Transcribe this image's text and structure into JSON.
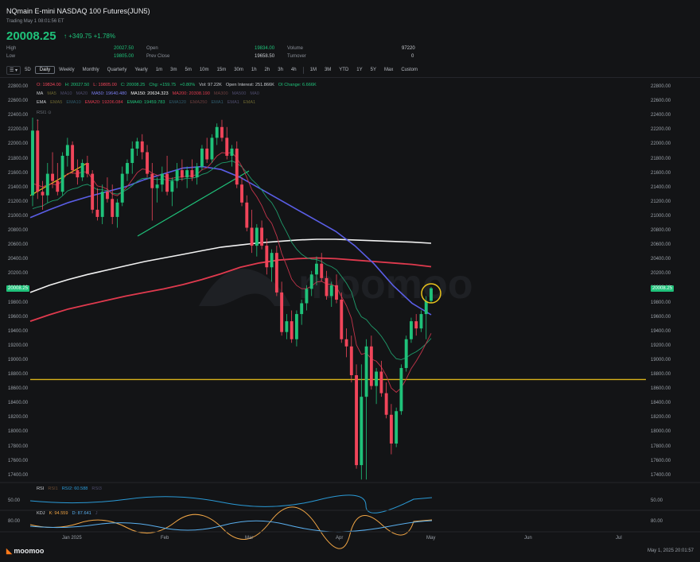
{
  "header": {
    "title": "NQmain  E-mini NASDAQ 100 Futures(JUN5)",
    "status": "Trading May 1 08:01:56 ET",
    "price": "20008.25",
    "arrow": "↑",
    "change": "+349.75 +1.78%"
  },
  "stats": [
    {
      "label": "High",
      "value": "20027.50",
      "color": "green"
    },
    {
      "label": "Low",
      "value": "19805.00",
      "color": "green"
    },
    {
      "label": "Open",
      "value": "19834.00",
      "color": "green"
    },
    {
      "label": "Prev Close",
      "value": "19658.50",
      "color": "plain"
    },
    {
      "label": "Volume",
      "value": "97220",
      "color": "plain"
    },
    {
      "label": "Turnover",
      "value": "0",
      "color": "plain"
    }
  ],
  "timeframes": [
    "5D",
    "Daily",
    "Weekly",
    "Monthly",
    "Quarterly",
    "Yearly",
    "1m",
    "3m",
    "5m",
    "10m",
    "15m",
    "30m",
    "1h",
    "2h",
    "3h",
    "4h",
    "1M",
    "3M",
    "YTD",
    "1Y",
    "5Y",
    "Max",
    "Custom"
  ],
  "active_timeframe": "Daily",
  "ohlc_legend": {
    "o": "O: 19834.00",
    "h": "H: 20027.50",
    "l": "L: 19805.00",
    "c": "C: 20008.25",
    "chg": "Chg: +159.75",
    "pct": "+0.80%",
    "vol": "Vol: 97.22K",
    "oi": "Open Interest: 251.866K",
    "oic": "OI Change: 6.666K"
  },
  "ma_legend": {
    "label": "MA",
    "ma5": "MA5",
    "ma10": "MA10",
    "ma20": "MA20",
    "ma50": "MA50: 19640.480",
    "ma150": "MA150: 20634.323",
    "ma200": "MA200: 20308.190",
    "ma300": "MA300",
    "ma500": "MA500",
    "ma0": "MA0"
  },
  "ema_legend": {
    "label": "EMA",
    "ema5": "EMA5",
    "ema10": "EMA10",
    "ema20": "EMA20: 19206.084",
    "ema40": "EMA40: 19459.783",
    "ema120": "EMA120",
    "ema250": "EMA250",
    "ema1a": "EMA1",
    "ema1b": "EMA1",
    "ema1c": "EMA1"
  },
  "rsi_small": "RSI1 ⊙",
  "price_axis": [
    "22800.00",
    "22600.00",
    "22400.00",
    "22200.00",
    "22000.00",
    "21800.00",
    "21600.00",
    "21400.00",
    "21200.00",
    "21000.00",
    "20800.00",
    "20600.00",
    "20400.00",
    "20200.00",
    "20000.00",
    "19800.00",
    "19600.00",
    "19400.00",
    "19200.00",
    "19000.00",
    "18800.00",
    "18600.00",
    "18400.00",
    "18200.00",
    "18000.00",
    "17800.00",
    "17600.00",
    "17400.00"
  ],
  "price_tag": "20008.25",
  "watermark": "moomoo",
  "rsi_panel": {
    "label": "RSI",
    "r1": "RSI1",
    "r2": "RSI2: 60.588",
    "r3": "RSI3",
    "level": "50.00"
  },
  "kdj_panel": {
    "label": "KDJ",
    "k": "K: 94.559",
    "d": "D: 87.641",
    "j": "J",
    "level": "80.00"
  },
  "x_axis": [
    "Jan 2025",
    "Feb",
    "Mar",
    "Apr",
    "May",
    "Jun",
    "Jul"
  ],
  "footer": {
    "logo": "moomoo",
    "time": "May 1, 2025 20:01:57"
  },
  "colors": {
    "up": "#1fc27a",
    "down": "#f0455a",
    "ma50": "#5a5ee6",
    "ma150": "#f2f2f2",
    "ma200": "#e03a4e",
    "ema40": "#1f9c6b",
    "ema20": "#c2344a",
    "support": "#d9b21a",
    "highlight": "#e8c21b"
  },
  "chart_data": {
    "type": "candlestick",
    "ylim": [
      17200,
      22900
    ],
    "support_level": 18740,
    "candles": [
      {
        "o": 21300,
        "h": 22380,
        "l": 21150,
        "c": 22200
      },
      {
        "o": 22200,
        "h": 22350,
        "l": 21250,
        "c": 21350
      },
      {
        "o": 21350,
        "h": 21500,
        "l": 21100,
        "c": 21300
      },
      {
        "o": 21300,
        "h": 21750,
        "l": 21200,
        "c": 21600
      },
      {
        "o": 21600,
        "h": 21900,
        "l": 21400,
        "c": 21500
      },
      {
        "o": 21500,
        "h": 21750,
        "l": 21300,
        "c": 21350
      },
      {
        "o": 21350,
        "h": 21900,
        "l": 21300,
        "c": 21850
      },
      {
        "o": 21850,
        "h": 22100,
        "l": 21700,
        "c": 22000
      },
      {
        "o": 22000,
        "h": 22050,
        "l": 21600,
        "c": 21650
      },
      {
        "o": 21650,
        "h": 21800,
        "l": 21450,
        "c": 21550
      },
      {
        "o": 21550,
        "h": 21800,
        "l": 21500,
        "c": 21750
      },
      {
        "o": 21750,
        "h": 21850,
        "l": 21550,
        "c": 21600
      },
      {
        "o": 21600,
        "h": 21650,
        "l": 21050,
        "c": 21100
      },
      {
        "o": 21100,
        "h": 21400,
        "l": 20950,
        "c": 21000
      },
      {
        "o": 21000,
        "h": 21450,
        "l": 20900,
        "c": 21350
      },
      {
        "o": 21350,
        "h": 21550,
        "l": 21200,
        "c": 21250
      },
      {
        "o": 21250,
        "h": 21450,
        "l": 20900,
        "c": 21000
      },
      {
        "o": 21000,
        "h": 21250,
        "l": 20850,
        "c": 21200
      },
      {
        "o": 21200,
        "h": 21700,
        "l": 21150,
        "c": 21600
      },
      {
        "o": 21600,
        "h": 21800,
        "l": 21500,
        "c": 21750
      },
      {
        "o": 21750,
        "h": 22050,
        "l": 21600,
        "c": 21950
      },
      {
        "o": 21950,
        "h": 22100,
        "l": 21850,
        "c": 22050
      },
      {
        "o": 22050,
        "h": 22150,
        "l": 21800,
        "c": 21900
      },
      {
        "o": 21900,
        "h": 22000,
        "l": 21550,
        "c": 21600
      },
      {
        "o": 21600,
        "h": 21750,
        "l": 20950,
        "c": 21400
      },
      {
        "o": 21400,
        "h": 21550,
        "l": 21200,
        "c": 21450
      },
      {
        "o": 21450,
        "h": 21700,
        "l": 21350,
        "c": 21600
      },
      {
        "o": 21600,
        "h": 21850,
        "l": 21300,
        "c": 21350
      },
      {
        "o": 21350,
        "h": 21550,
        "l": 21150,
        "c": 21500
      },
      {
        "o": 21500,
        "h": 21750,
        "l": 21400,
        "c": 21650
      },
      {
        "o": 21650,
        "h": 21800,
        "l": 21500,
        "c": 21550
      },
      {
        "o": 21550,
        "h": 21700,
        "l": 21400,
        "c": 21650
      },
      {
        "o": 21650,
        "h": 21800,
        "l": 21500,
        "c": 21550
      },
      {
        "o": 21550,
        "h": 21750,
        "l": 21450,
        "c": 21700
      },
      {
        "o": 21700,
        "h": 22000,
        "l": 21650,
        "c": 21950
      },
      {
        "o": 21950,
        "h": 22100,
        "l": 21750,
        "c": 21800
      },
      {
        "o": 21800,
        "h": 22150,
        "l": 21750,
        "c": 22100
      },
      {
        "o": 22100,
        "h": 22300,
        "l": 22000,
        "c": 22250
      },
      {
        "o": 22250,
        "h": 22350,
        "l": 22050,
        "c": 22100
      },
      {
        "o": 22100,
        "h": 22250,
        "l": 21800,
        "c": 21850
      },
      {
        "o": 21850,
        "h": 22000,
        "l": 21700,
        "c": 21950
      },
      {
        "o": 21950,
        "h": 22050,
        "l": 21400,
        "c": 21450
      },
      {
        "o": 21450,
        "h": 21550,
        "l": 21150,
        "c": 21200
      },
      {
        "o": 21200,
        "h": 21300,
        "l": 20800,
        "c": 20850
      },
      {
        "o": 20850,
        "h": 21100,
        "l": 20500,
        "c": 20600
      },
      {
        "o": 20600,
        "h": 20900,
        "l": 20450,
        "c": 20850
      },
      {
        "o": 20850,
        "h": 20950,
        "l": 20550,
        "c": 20600
      },
      {
        "o": 20600,
        "h": 20700,
        "l": 20200,
        "c": 20300
      },
      {
        "o": 20300,
        "h": 20550,
        "l": 20100,
        "c": 20500
      },
      {
        "o": 20500,
        "h": 20600,
        "l": 19900,
        "c": 19950
      },
      {
        "o": 19950,
        "h": 20100,
        "l": 19350,
        "c": 19400
      },
      {
        "o": 19400,
        "h": 19650,
        "l": 19300,
        "c": 19550
      },
      {
        "o": 19550,
        "h": 19700,
        "l": 19250,
        "c": 19300
      },
      {
        "o": 19300,
        "h": 19700,
        "l": 19200,
        "c": 19650
      },
      {
        "o": 19650,
        "h": 19850,
        "l": 19500,
        "c": 19800
      },
      {
        "o": 19800,
        "h": 20050,
        "l": 19700,
        "c": 20000
      },
      {
        "o": 20000,
        "h": 20250,
        "l": 19900,
        "c": 20200
      },
      {
        "o": 20200,
        "h": 20450,
        "l": 20050,
        "c": 20350
      },
      {
        "o": 20350,
        "h": 20500,
        "l": 20100,
        "c": 20150
      },
      {
        "o": 20150,
        "h": 20250,
        "l": 19850,
        "c": 19900
      },
      {
        "o": 19900,
        "h": 20100,
        "l": 19750,
        "c": 20050
      },
      {
        "o": 20050,
        "h": 20200,
        "l": 19800,
        "c": 19850
      },
      {
        "o": 19850,
        "h": 19950,
        "l": 19250,
        "c": 19300
      },
      {
        "o": 19300,
        "h": 19450,
        "l": 19050,
        "c": 19200
      },
      {
        "o": 19200,
        "h": 19350,
        "l": 18700,
        "c": 18800
      },
      {
        "o": 18800,
        "h": 18950,
        "l": 17500,
        "c": 17550
      },
      {
        "o": 17550,
        "h": 18950,
        "l": 17350,
        "c": 18500
      },
      {
        "o": 18500,
        "h": 19300,
        "l": 17350,
        "c": 19200
      },
      {
        "o": 19200,
        "h": 19350,
        "l": 18600,
        "c": 18650
      },
      {
        "o": 18650,
        "h": 18900,
        "l": 18400,
        "c": 18850
      },
      {
        "o": 18850,
        "h": 19000,
        "l": 18500,
        "c": 18550
      },
      {
        "o": 18550,
        "h": 18700,
        "l": 18200,
        "c": 18250
      },
      {
        "o": 18250,
        "h": 18400,
        "l": 17700,
        "c": 17850
      },
      {
        "o": 17850,
        "h": 18350,
        "l": 17800,
        "c": 18300
      },
      {
        "o": 18300,
        "h": 18950,
        "l": 18250,
        "c": 18900
      },
      {
        "o": 18900,
        "h": 19350,
        "l": 18850,
        "c": 19300
      },
      {
        "o": 19300,
        "h": 19600,
        "l": 19250,
        "c": 19550
      },
      {
        "o": 19550,
        "h": 19650,
        "l": 19350,
        "c": 19450
      },
      {
        "o": 19450,
        "h": 19700,
        "l": 19400,
        "c": 19650
      },
      {
        "o": 19650,
        "h": 19900,
        "l": 19300,
        "c": 19830
      },
      {
        "o": 19834,
        "h": 20027.5,
        "l": 19805,
        "c": 20008.25
      }
    ]
  }
}
